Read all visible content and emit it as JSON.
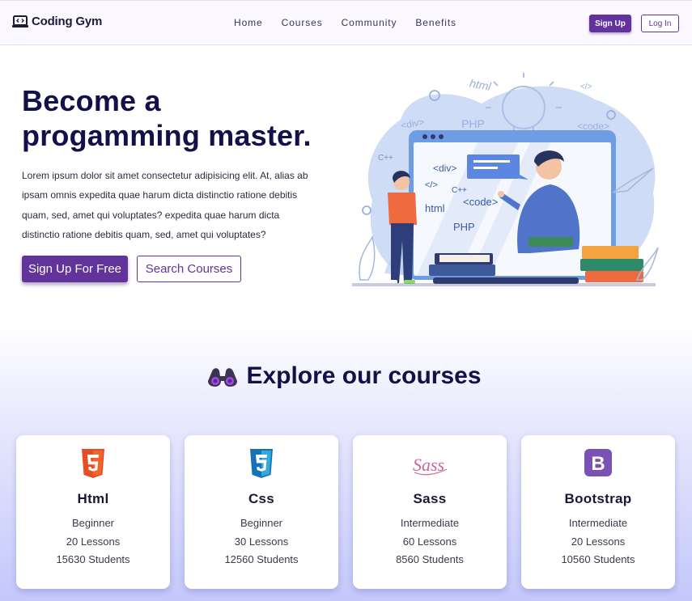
{
  "navbar": {
    "brand": "Coding Gym",
    "links": [
      "Home",
      "Courses",
      "Community",
      "Benefits"
    ],
    "signup_label": "Sign Up",
    "login_label": "Log In"
  },
  "hero": {
    "title_line1": "Become a",
    "title_line2": "progamming master.",
    "description": "Lorem ipsum dolor sit amet consectetur adipisicing elit. At, alias ab ipsam omnis expedita quae harum dicta distinctio ratione debitis quam, sed, amet qui voluptates? expedita quae harum dicta distinctio ratione debitis quam, sed, amet qui voluptates?",
    "primary_button": "Sign Up For Free",
    "secondary_button": "Search Courses",
    "illustration_labels": [
      "html",
      "PHP",
      "<div>",
      "<code>",
      "</>",
      "C++",
      "</>",
      "html",
      "PHP",
      "<div>",
      "<code>",
      "C++"
    ]
  },
  "courses_section": {
    "title": "Explore our courses",
    "icon": "binoculars-icon",
    "courses": [
      {
        "name": "Html",
        "level": "Beginner",
        "lessons": "20 Lessons",
        "students": "15630 Students",
        "icon": "html5-icon",
        "color": "#e44d26"
      },
      {
        "name": "Css",
        "level": "Beginner",
        "lessons": "30 Lessons",
        "students": "12560 Students",
        "icon": "css3-icon",
        "color": "#1572b6"
      },
      {
        "name": "Sass",
        "level": "Intermediate",
        "lessons": "60 Lessons",
        "students": "8560 Students",
        "icon": "sass-icon",
        "color": "#cd6799"
      },
      {
        "name": "Bootstrap",
        "level": "Intermediate",
        "lessons": "20 Lessons",
        "students": "10560 Students",
        "icon": "bootstrap-icon",
        "color": "#7952b3"
      }
    ]
  },
  "colors": {
    "primary": "#61339b",
    "heading": "#14104a",
    "illustration_blue": "#5b8ee6"
  }
}
